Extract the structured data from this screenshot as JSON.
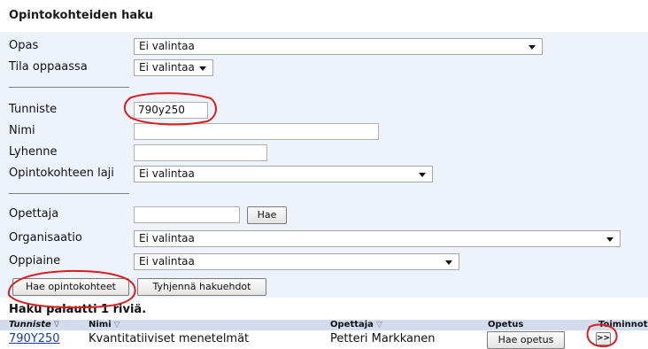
{
  "page_title": "Opintokohteiden haku",
  "form": {
    "opas": {
      "label": "Opas",
      "value": "Ei valintaa"
    },
    "tila_oppaassa": {
      "label": "Tila oppaassa",
      "value": "Ei valintaa"
    },
    "tunniste": {
      "label": "Tunniste",
      "value": "790y250"
    },
    "nimi": {
      "label": "Nimi",
      "value": ""
    },
    "lyhenne": {
      "label": "Lyhenne",
      "value": ""
    },
    "laji": {
      "label": "Opintokohteen laji",
      "value": "Ei valintaa"
    },
    "opettaja": {
      "label": "Opettaja",
      "value": "",
      "button": "Hae"
    },
    "organisaatio": {
      "label": "Organisaatio",
      "value": "Ei valintaa"
    },
    "oppiaine": {
      "label": "Oppiaine",
      "value": "Ei valintaa"
    }
  },
  "buttons": {
    "search": "Hae opintokohteet",
    "clear": "Tyhjennä hakuehdot"
  },
  "results": {
    "summary": "Haku palautti 1 riviä.",
    "columns": [
      "Tunniste",
      "Nimi",
      "Opettaja",
      "Opetus",
      "Toiminnot"
    ],
    "sort_icons": [
      "∇",
      "▽",
      "▽"
    ],
    "rows": [
      {
        "tunniste": "790Y250",
        "nimi": "Kvantitatiiviset menetelmät",
        "opettaja": "Petteri Markkanen",
        "opetus_button": "Hae opetus",
        "action_button": ">>"
      }
    ]
  },
  "colors": {
    "panel": "#eef3fb",
    "table_header": "#d3dced",
    "link": "#1a3d9c",
    "annotation": "#d81e1e"
  }
}
